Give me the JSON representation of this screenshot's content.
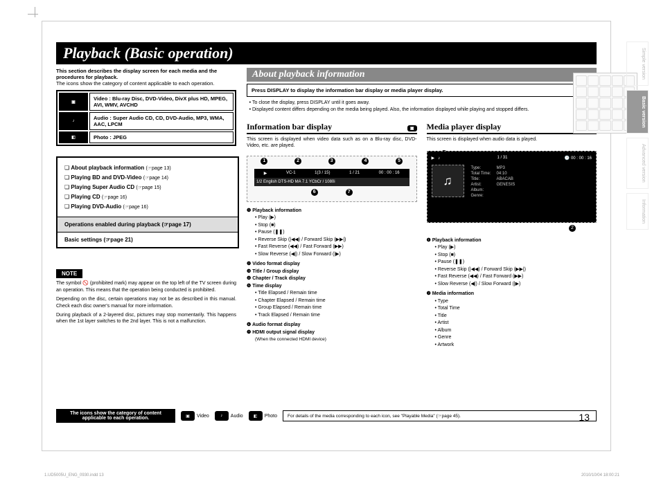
{
  "lang": "ENGLISH",
  "side_tabs": [
    "Simple version",
    "Basic version",
    "Advanced version",
    "Information"
  ],
  "title": "Playback (Basic operation)",
  "intro1": "This section describes the display screen for each media and the procedures for playback.",
  "intro2": "The icons show the category of content applicable to each operation.",
  "media_rows": [
    "Video : Blu-ray Disc, DVD-Video, DivX plus HD, MPEG, AVI, WMV, AVCHD",
    "Audio : Super Audio CD, CD, DVD-Audio, MP3, WMA, AAC, LPCM",
    "Photo : JPEG"
  ],
  "toc": [
    {
      "t": "About playback information",
      "p": "(☞page 13)"
    },
    {
      "t": "Playing BD and DVD-Video",
      "p": "(☞page 14)"
    },
    {
      "t": "Playing Super Audio CD",
      "p": "(☞page 15)"
    },
    {
      "t": "Playing CD",
      "p": "(☞page 16)"
    },
    {
      "t": "Playing DVD-Audio",
      "p": "(☞page 16)"
    }
  ],
  "toc_grey": "Operations enabled during playback (☞page 17)",
  "toc_last": "Basic settings (☞page 21)",
  "note_label": "NOTE",
  "notes": [
    "The symbol 🚫 (prohibited mark) may appear on the top left of the TV screen during an operation. This means that the operation being conducted is prohibited.",
    "Depending on the disc, certain operations may not be as described in this manual. Check each disc owner's manual for more information.",
    "During playback of a 2-layered disc, pictures may stop momentarily. This happens when the 1st layer switches to the 2nd layer. This is not a malfunction."
  ],
  "about_hdr": "About playback information",
  "about_instr": "Press DISPLAY to display the information bar display or media player display.",
  "about_bullets": [
    "To close the display, press DISPLAY until it goes away.",
    "Displayed content differs depending on the media being played. Also, the information displayed while playing and stopped differs."
  ],
  "info_bar": {
    "hdr": "Information bar display",
    "cap": "This screen is displayed when video data such as on a Blu-ray disc, DVD-Video, etc. are played.",
    "row1": [
      "▶",
      "VC-1",
      "1(3 / 15)",
      "1 / 21",
      "00 : 00 : 16"
    ],
    "row2": "1/2  English  DTS-HD MA 7.1        YCbCr / 1080i",
    "defs": [
      {
        "n": "❶",
        "h": "Playback information",
        "items": [
          "Play (▶)",
          "Stop (■)",
          "Pause (❚❚)",
          "Reverse Skip (|◀◀) / Forward Skip (▶▶|)",
          "Fast Reverse (◀◀) / Fast Forward (▶▶)",
          "Slow Reverse (◀|) / Slow Forward (|▶)"
        ]
      },
      {
        "n": "❷",
        "h": "Video format display"
      },
      {
        "n": "❸",
        "h": "Title / Group display"
      },
      {
        "n": "❹",
        "h": "Chapter / Track display"
      },
      {
        "n": "❺",
        "h": "Time display",
        "items": [
          "Title Elapsed / Remain time",
          "Chapter Elapsed / Remain time",
          "Group Elapsed / Remain time",
          "Track Elapsed / Remain time"
        ]
      },
      {
        "n": "❻",
        "h": "Audio format display"
      },
      {
        "n": "❼",
        "h": "HDMI output signal display",
        "note": "(When the connected HDMI device)"
      }
    ]
  },
  "media_player": {
    "hdr": "Media player display",
    "cap": "This screen is displayed when audio data is played.",
    "top": {
      "track": "1  /  31",
      "time": "00 : 00 : 16"
    },
    "artwork": "♫",
    "info": [
      [
        "Type:",
        "MP3"
      ],
      [
        "Total Time:",
        "04:10"
      ],
      [
        "Title:",
        "ABACAB"
      ],
      [
        "Artist:",
        "GENESIS"
      ],
      [
        "Album:",
        ""
      ],
      [
        "Genre:",
        ""
      ]
    ],
    "defs": [
      {
        "n": "❶",
        "h": "Playback information",
        "items": [
          "Play (▶)",
          "Stop (■)",
          "Pause (❚❚)",
          "Reverse Skip (|◀◀) / Forward Skip (▶▶|)",
          "Fast Reverse (◀◀) / Fast Forward (▶▶)",
          "Slow Reverse (◀|) / Slow Forward (|▶)"
        ]
      },
      {
        "n": "❷",
        "h": "Media information",
        "items": [
          "Type",
          "Total Time",
          "Title",
          "Artist",
          "Album",
          "Genre",
          "Artwork"
        ]
      }
    ]
  },
  "footer": {
    "blk": "The icons show the category of content applicable to each operation.",
    "labels": [
      "Video",
      "Audio",
      "Photo"
    ],
    "right": "For details of the media corresponding to each icon, see \"Playable Media\" (☞page 45)."
  },
  "page_num": "13",
  "imprint_left": "1.UD5005U_ENG_0930.indd   13",
  "imprint_right": "2010/10/04   18:00:21"
}
